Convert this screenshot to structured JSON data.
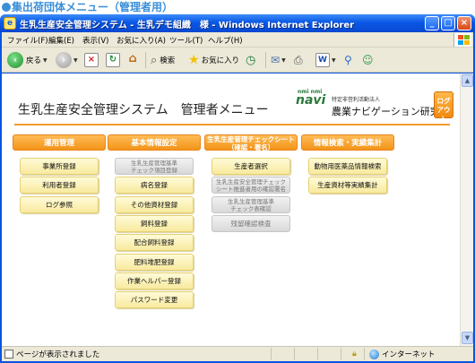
{
  "caption": "集出荷団体メニュー（管理者用）",
  "window": {
    "title": "生乳生産安全管理システム - 生乳デモ組織　様 - Windows Internet Explorer"
  },
  "menubar": {
    "items": [
      "ファイル(F)",
      "編集(E)",
      "表示(V)",
      "お気に入り(A)",
      "ツール(T)",
      "ヘルプ(H)"
    ]
  },
  "toolbar": {
    "back_label": "戻る",
    "search_label": "検索",
    "favorites_label": "お気に入り"
  },
  "header": {
    "page_title": "生乳生産安全管理システム　管理者メニュー",
    "logo_mark": "navi",
    "logo_mark_small": "nmi nmi",
    "logo_sub": "特定非営利活動法人",
    "logo_name": "農業ナビゲーション研究所",
    "logout_line1": "ログ",
    "logout_line2": "アウト"
  },
  "columns": [
    {
      "header": [
        "運用管理"
      ],
      "buttons": [
        {
          "label": [
            "事業所登録"
          ],
          "enabled": true
        },
        {
          "label": [
            "利用者登録"
          ],
          "enabled": true
        },
        {
          "label": [
            "ログ参照"
          ],
          "enabled": true
        }
      ]
    },
    {
      "header": [
        "基本情報設定"
      ],
      "buttons": [
        {
          "label": [
            "生乳生産管理基準",
            "チェック項目登録"
          ],
          "enabled": false
        },
        {
          "label": [
            "病名登録"
          ],
          "enabled": true
        },
        {
          "label": [
            "その他資材登録"
          ],
          "enabled": true
        },
        {
          "label": [
            "飼料登録"
          ],
          "enabled": true
        },
        {
          "label": [
            "配合飼料登録"
          ],
          "enabled": true
        },
        {
          "label": [
            "肥料堆肥登録"
          ],
          "enabled": true
        },
        {
          "label": [
            "作業ヘルパー登録"
          ],
          "enabled": true
        },
        {
          "label": [
            "パスワード変更"
          ],
          "enabled": true
        }
      ]
    },
    {
      "header": [
        "生乳生産管理チェックシート",
        "（確認・署名）"
      ],
      "buttons": [
        {
          "label": [
            "生産者選択"
          ],
          "enabled": true
        },
        {
          "label": [
            "生乳生産安全管理チェック",
            "シート推進者用の確認署名"
          ],
          "enabled": false
        },
        {
          "label": [
            "生乳生産管理基準",
            "チェック表確認"
          ],
          "enabled": false
        },
        {
          "label": [
            "残留確認検査"
          ],
          "enabled": false
        }
      ]
    },
    {
      "header": [
        "情報検索・実績集計"
      ],
      "buttons": [
        {
          "label": [
            "動物用医薬品情報検索"
          ],
          "enabled": true
        },
        {
          "label": [
            "生産資材等実績集計"
          ],
          "enabled": true
        }
      ]
    }
  ],
  "statusbar": {
    "text": "ページが表示されました",
    "zone": "インターネット"
  }
}
